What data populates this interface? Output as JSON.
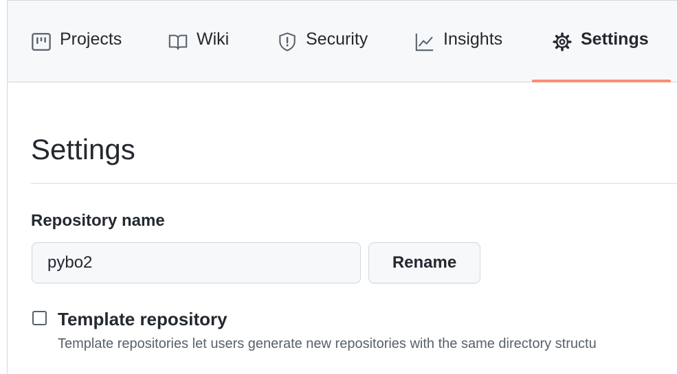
{
  "tabs": [
    {
      "label": "Projects",
      "icon": "project-board-icon",
      "selected": false
    },
    {
      "label": "Wiki",
      "icon": "book-icon",
      "selected": false
    },
    {
      "label": "Security",
      "icon": "shield-icon",
      "selected": false
    },
    {
      "label": "Insights",
      "icon": "graph-icon",
      "selected": false
    },
    {
      "label": "Settings",
      "icon": "gear-icon",
      "selected": true
    }
  ],
  "colors": {
    "selected_underline": "#fd8c73",
    "text": "#24292f",
    "muted": "#57606a",
    "border": "#d0d7de"
  },
  "main": {
    "title": "Settings",
    "repository_name_label": "Repository name",
    "repository_name_value": "pybo2",
    "rename_label": "Rename",
    "template": {
      "checked": false,
      "label": "Template repository",
      "note": "Template repositories let users generate new repositories with the same directory structu"
    }
  }
}
